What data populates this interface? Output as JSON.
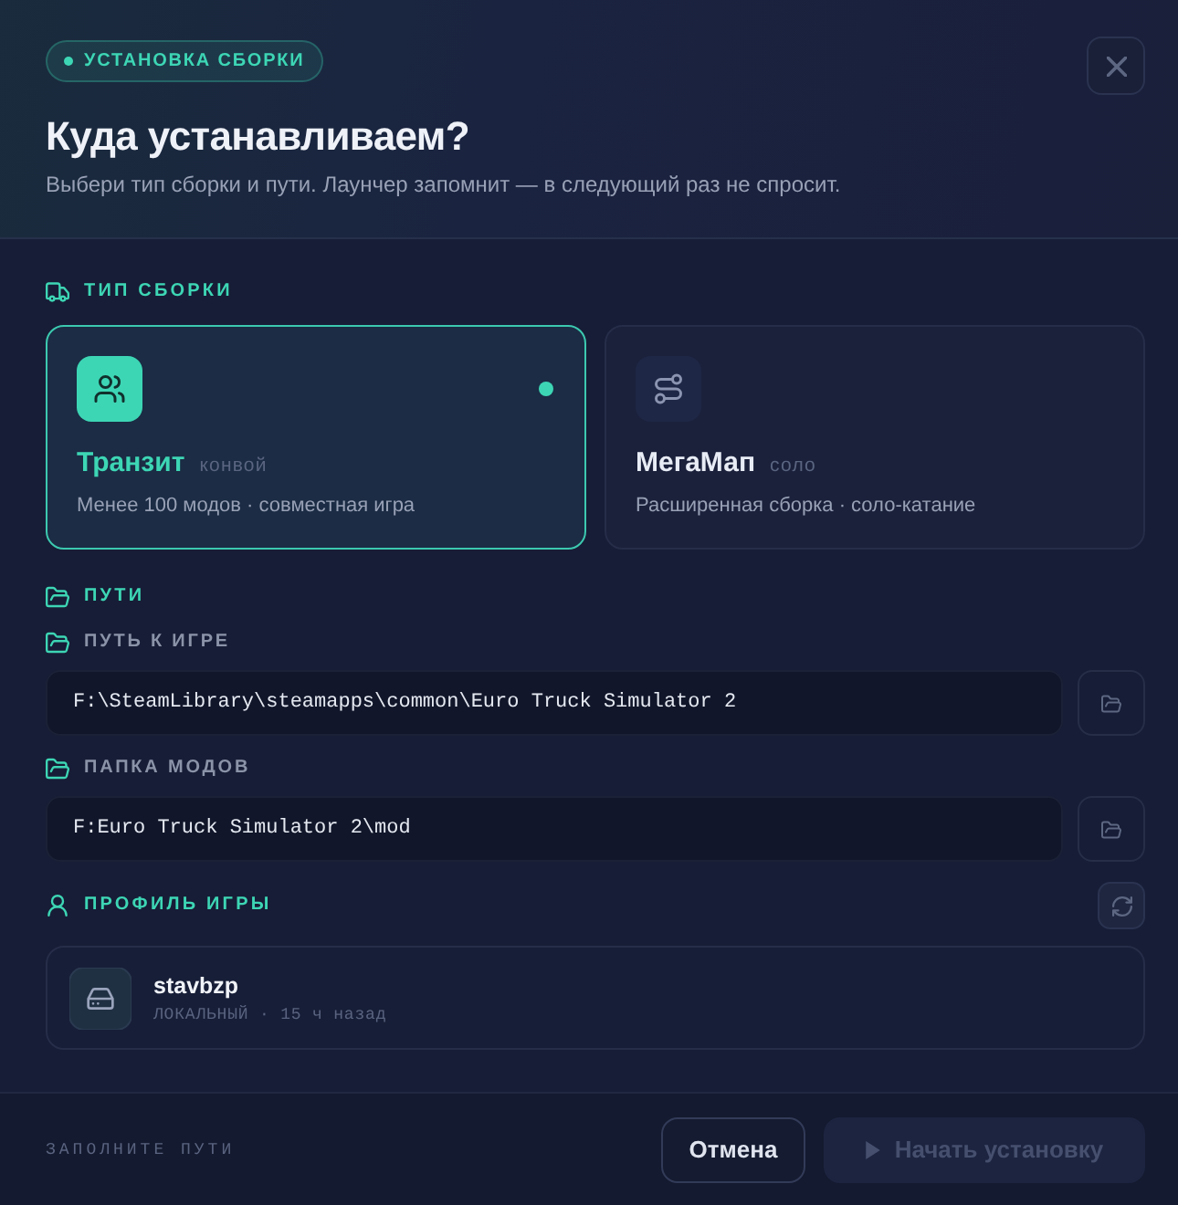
{
  "header": {
    "badge": "УСТАНОВКА СБОРКИ",
    "title": "Куда устанавливаем?",
    "subtitle": "Выбери тип сборки и пути. Лаунчер запомнит — в следующий раз не спросит."
  },
  "build_type": {
    "heading": "ТИП СБОРКИ",
    "options": [
      {
        "kind": "convoy",
        "name": "Транзит",
        "tag": "конвой",
        "description": "Менее 100 модов · совместная игра",
        "selected": true
      },
      {
        "kind": "solo",
        "name": "МегаМап",
        "tag": "соло",
        "description": "Расширенная сборка · соло-катание",
        "selected": false
      }
    ]
  },
  "paths": {
    "heading": "ПУТИ",
    "fields": [
      {
        "label": "ПУТЬ К ИГРЕ",
        "value": "F:\\SteamLibrary\\steamapps\\common\\Euro Truck Simulator 2"
      },
      {
        "label": "ПАПКА МОДОВ",
        "value": "F:Euro Truck Simulator 2\\mod"
      }
    ]
  },
  "profile": {
    "heading": "ПРОФИЛЬ ИГРЫ",
    "name": "stavbzp",
    "meta": "ЛОКАЛЬНЫЙ · 15 ч назад"
  },
  "footer": {
    "status": "ЗАПОЛНИТЕ ПУТИ",
    "buttons": [
      {
        "kind": "secondary",
        "label": "Отмена",
        "disabled": false
      },
      {
        "kind": "primary",
        "label": "Начать установку",
        "disabled": true
      }
    ]
  }
}
